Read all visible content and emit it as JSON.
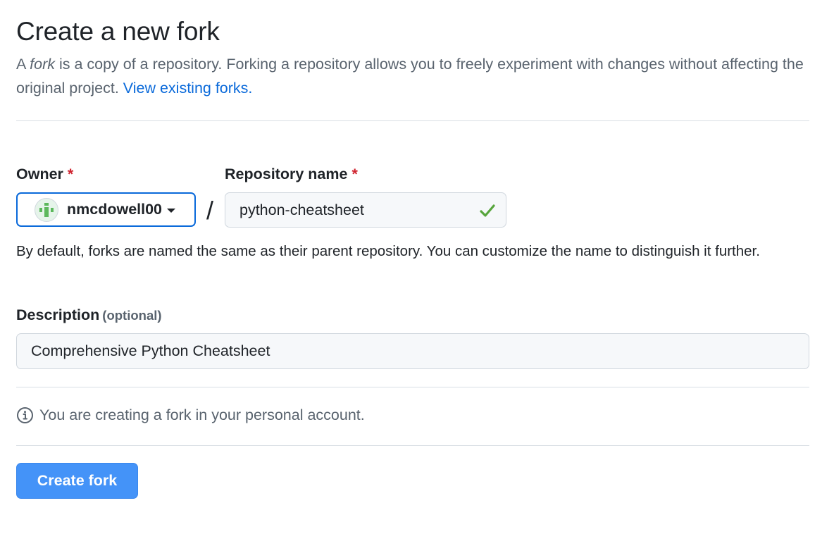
{
  "header": {
    "title": "Create a new fork",
    "intro_prefix": "A ",
    "intro_fork_word": "fork",
    "intro_rest": " is a copy of a repository. Forking a repository allows you to freely experiment with changes without affecting the original project. ",
    "view_forks_link": "View existing forks."
  },
  "form": {
    "owner": {
      "label": "Owner",
      "required_mark": "*",
      "selected": "nmcdowell00",
      "avatar_icon": "identicon-avatar"
    },
    "separator": "/",
    "repository": {
      "label": "Repository name",
      "required_mark": "*",
      "value": "python-cheatsheet",
      "valid_icon": "check-icon",
      "valid_color": "#57a53c"
    },
    "name_hint": "By default, forks are named the same as their parent repository. You can customize the name to distinguish it further.",
    "description": {
      "label": "Description",
      "optional_tag": "(optional)",
      "value": "Comprehensive Python Cheatsheet"
    },
    "info": {
      "icon": "info-icon",
      "text": "You are creating a fork in your personal account."
    },
    "submit": {
      "label": "Create fork",
      "color": "#4493f8"
    }
  }
}
